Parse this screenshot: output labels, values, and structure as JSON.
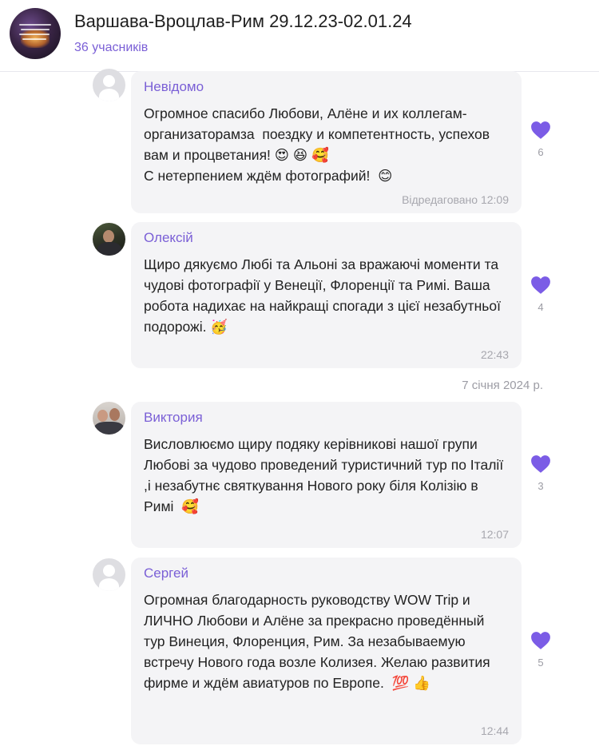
{
  "header": {
    "title": "Варшава-Вроцлав-Рим 29.12.23-02.01.24",
    "members": "36 учасників"
  },
  "messages": [
    {
      "sender": "Невідомо",
      "text": "Огромное спасибо Любови, Алёне и их коллегам-организаторамза  поездку и компетентность, успехов вам и процветания! 😍 😆 🥰\nС нетерпением ждём фотографий!  😊",
      "time": "Відредаговано 12:09",
      "reactions": "6",
      "avatar": "placeholder"
    },
    {
      "sender": "Олексій",
      "text": "Щиро дякуємо Любі та Альоні за вражаючі моменти та чудові фотографії у Венеції, Флоренції та Римі. Ваша робота надихає на найкращі спогади з цієї незабутньої подорожі. 🥳",
      "time": "22:43",
      "reactions": "4",
      "avatar": "photo"
    },
    {
      "sender": "Виктория",
      "text": "Висловлюємо щиру подяку керівникові нашої групи Любові за чудово проведений туристичний тур по Італії ,і незабутнє святкування Нового року біля Колізію в Римі  🥰",
      "time": "12:07",
      "reactions": "3",
      "avatar": "photo"
    },
    {
      "sender": "Сергей",
      "text": "Огромная благодарность руководству WOW Trip и ЛИЧНО Любови и Алёне за прекрасно проведённый тур Винеция, Флоренция, Рим. За незабываемую встречу Нового года возле Колизея. Желаю развития фирме и ждём авиатуров по Европе.  💯 👍",
      "time": "12:44",
      "reactions": "5",
      "avatar": "placeholder"
    }
  ],
  "date_separator": "7 січня 2024 р.",
  "colors": {
    "accent": "#7a5fd6",
    "heart": "#7b5ce6",
    "bubble": "#f4f4f6"
  }
}
